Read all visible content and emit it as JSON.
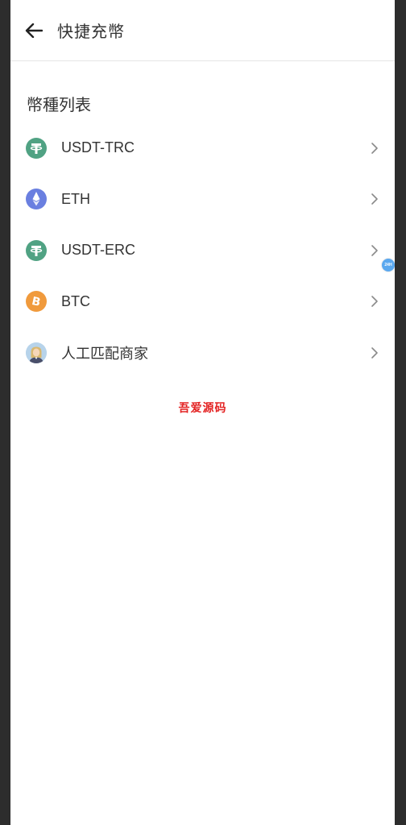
{
  "header": {
    "title": "快捷充幣"
  },
  "section": {
    "title": "幣種列表"
  },
  "coins": [
    {
      "label": "USDT-TRC",
      "icon": "tether-icon",
      "color": "#50a283"
    },
    {
      "label": "ETH",
      "icon": "ethereum-icon",
      "color": "#6a7fe0"
    },
    {
      "label": "USDT-ERC",
      "icon": "tether-icon",
      "color": "#50a283"
    },
    {
      "label": "BTC",
      "icon": "bitcoin-icon",
      "color": "#f09a3c"
    },
    {
      "label": "人工匹配商家",
      "icon": "merchant-avatar-icon",
      "color": "#b7d3ea"
    }
  ],
  "watermark": "吾爱源码",
  "float_badge": "24H"
}
